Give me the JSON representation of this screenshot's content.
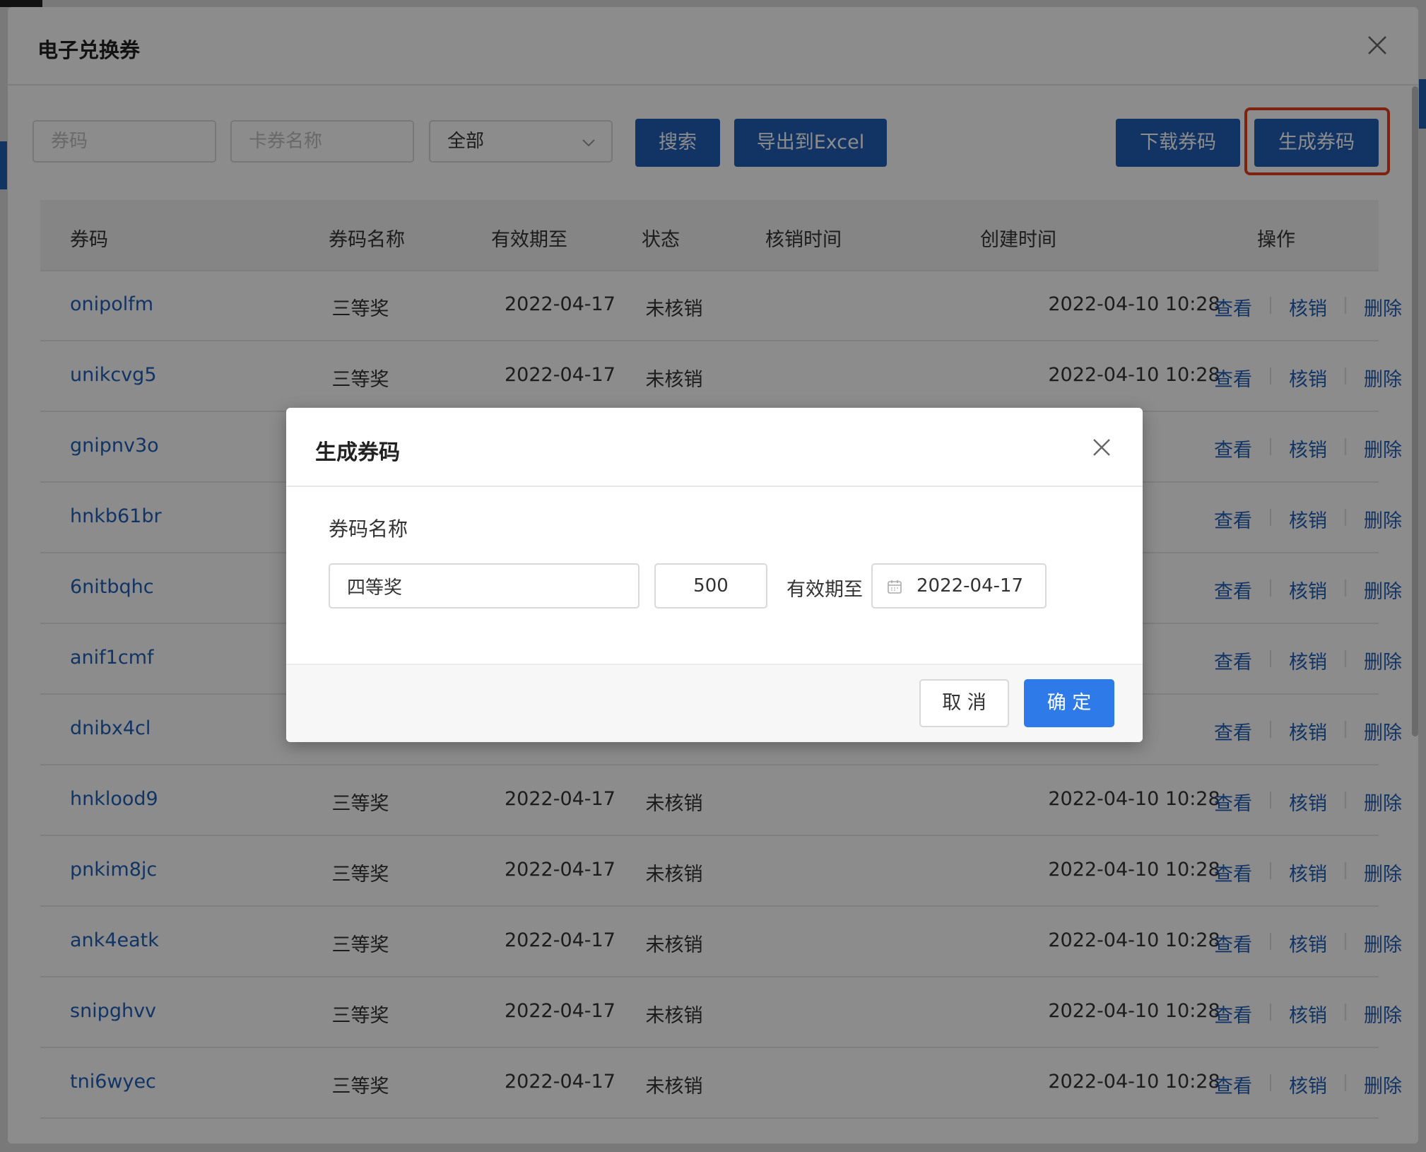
{
  "dialog": {
    "title": "电子兑换券"
  },
  "filters": {
    "code_placeholder": "券码",
    "name_placeholder": "卡券名称",
    "status_value": "全部",
    "search_label": "搜索",
    "export_label": "导出到Excel",
    "download_label": "下载券码",
    "generate_label": "生成券码"
  },
  "table": {
    "headers": [
      "券码",
      "券码名称",
      "有效期至",
      "状态",
      "核销时间",
      "创建时间",
      "操作"
    ],
    "actions": [
      "查看",
      "核销",
      "删除"
    ],
    "rows": [
      {
        "code": "onipolfm",
        "name": "三等奖",
        "expiry": "2022-04-17",
        "status": "未核销",
        "redeemed": "",
        "created": "2022-04-10 10:28"
      },
      {
        "code": "unikcvg5",
        "name": "三等奖",
        "expiry": "2022-04-17",
        "status": "未核销",
        "redeemed": "",
        "created": "2022-04-10 10:28"
      },
      {
        "code": "gnipnv3o",
        "name": "",
        "expiry": "",
        "status": "",
        "redeemed": "",
        "created": ""
      },
      {
        "code": "hnkb61br",
        "name": "",
        "expiry": "",
        "status": "",
        "redeemed": "",
        "created": ""
      },
      {
        "code": "6nitbqhc",
        "name": "",
        "expiry": "",
        "status": "",
        "redeemed": "",
        "created": ""
      },
      {
        "code": "anif1cmf",
        "name": "",
        "expiry": "",
        "status": "",
        "redeemed": "",
        "created": ""
      },
      {
        "code": "dnibx4cl",
        "name": "",
        "expiry": "",
        "status": "",
        "redeemed": "",
        "created": ""
      },
      {
        "code": "hnklood9",
        "name": "三等奖",
        "expiry": "2022-04-17",
        "status": "未核销",
        "redeemed": "",
        "created": "2022-04-10 10:28"
      },
      {
        "code": "pnkim8jc",
        "name": "三等奖",
        "expiry": "2022-04-17",
        "status": "未核销",
        "redeemed": "",
        "created": "2022-04-10 10:28"
      },
      {
        "code": "ank4eatk",
        "name": "三等奖",
        "expiry": "2022-04-17",
        "status": "未核销",
        "redeemed": "",
        "created": "2022-04-10 10:28"
      },
      {
        "code": "snipghvv",
        "name": "三等奖",
        "expiry": "2022-04-17",
        "status": "未核销",
        "redeemed": "",
        "created": "2022-04-10 10:28"
      },
      {
        "code": "tni6wyec",
        "name": "三等奖",
        "expiry": "2022-04-17",
        "status": "未核销",
        "redeemed": "",
        "created": "2022-04-10 10:28"
      }
    ]
  },
  "modal": {
    "title": "生成券码",
    "label": "券码名称",
    "name_value": "四等奖",
    "quantity_value": "500",
    "expiry_label": "有效期至",
    "expiry_value": "2022-04-17",
    "cancel_label": "取 消",
    "ok_label": "确 定"
  },
  "colors": {
    "primary": "#1f5fb8",
    "ok_button": "#2d7ae8",
    "highlight": "#e7401f"
  },
  "icons": [
    "close-icon",
    "chevron-down-icon",
    "calendar-icon"
  ]
}
